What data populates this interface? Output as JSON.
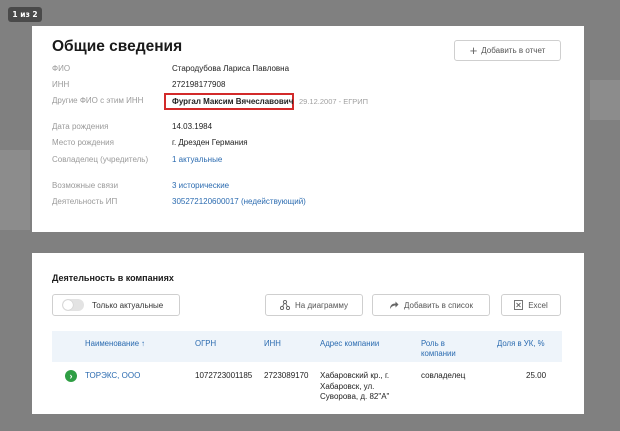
{
  "counter": "1 из 2",
  "general": {
    "title": "Общие сведения",
    "add_report_label": "Добавить в отчет",
    "fields": [
      {
        "label": "ФИО",
        "value": "Стародубова Лариса Павловна"
      },
      {
        "label": "ИНН",
        "value": "272198177908"
      },
      {
        "label": "Другие ФИО с этим ИНН",
        "value": "Фургал Максим Вячеславович",
        "suffix": "29.12.2007 - ЕГРИП"
      },
      {
        "label": "Дата рождения",
        "value": "14.03.1984"
      },
      {
        "label": "Место рождения",
        "value": "г. Дрезден Германия"
      },
      {
        "label": "Совладелец (учредитель)",
        "value": "1 актуальные"
      },
      {
        "label": "Возможные связи",
        "value": "3 исторические"
      },
      {
        "label": "Деятельность ИП",
        "value": "305272120600017 (недействующий)"
      }
    ]
  },
  "companies": {
    "title": "Деятельность в компаниях",
    "toggle_label": "Только актуальные",
    "diagram_label": "На диаграмму",
    "add_list_label": "Добавить в список",
    "excel_label": "Excel",
    "columns": {
      "name": "Наименование ↑",
      "ogrn": "ОГРН",
      "inn": "ИНН",
      "address": "Адрес компании",
      "role": "Роль в компании",
      "share": "Доля в УК, %"
    },
    "rows": [
      {
        "name": "ТОРЭКС, ООО",
        "ogrn": "1072723001185",
        "inn": "2723089170",
        "address": "Хабаровский кр., г. Хабаровск, ул. Суворова, д. 82\"А\"",
        "role": "совладелец",
        "share": "25.00"
      }
    ]
  },
  "colors": {
    "accent_link": "#2b6bb0",
    "highlight_border": "#d22a2a",
    "status_active": "#2f9e44",
    "overlay": "#808080"
  }
}
